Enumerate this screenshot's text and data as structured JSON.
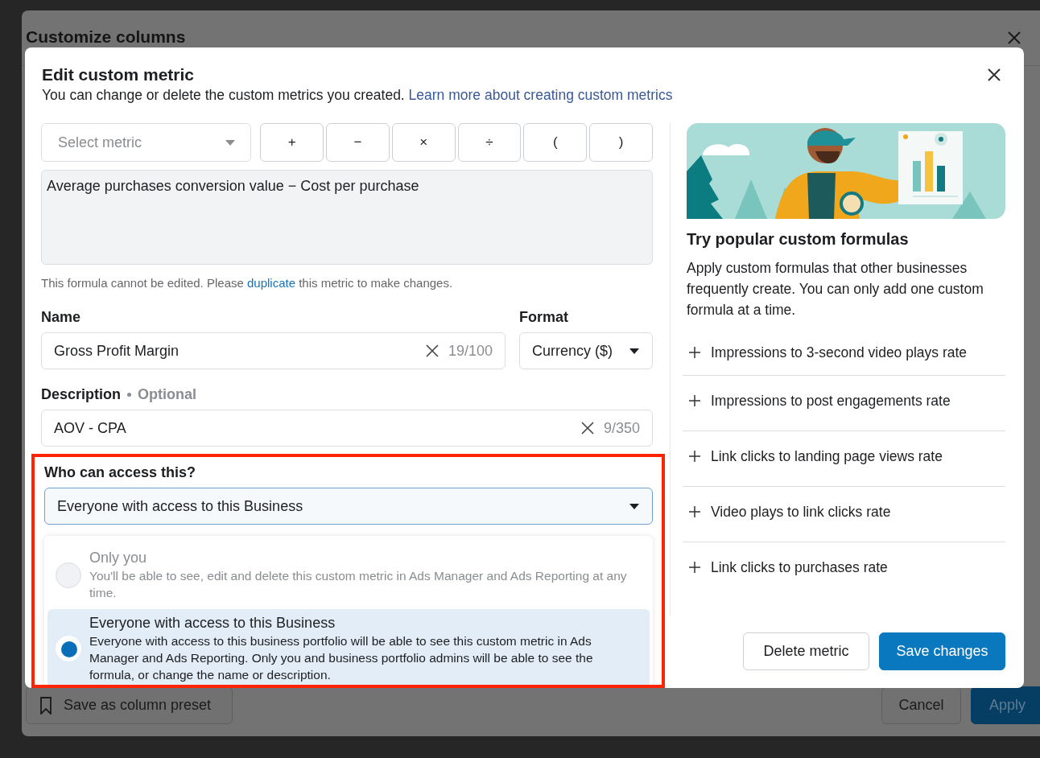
{
  "background_window": {
    "title": "Customize columns",
    "footer_left_button": "Save as column preset",
    "footer_buttons": [
      {
        "label": "Cancel",
        "kind": "secondary"
      },
      {
        "label": "Apply",
        "kind": "primary"
      }
    ]
  },
  "dialog": {
    "title": "Edit custom metric",
    "subtitle": "You can change or delete the custom metrics you created.",
    "subtitle_link": "Learn more about creating custom metrics",
    "metric_select": {
      "placeholder": "Select metric"
    },
    "operator_buttons": [
      "+",
      "−",
      "×",
      "÷",
      "(",
      ")"
    ],
    "formula": "Average purchases conversion value − Cost per purchase",
    "formula_note": {
      "before": "This formula cannot be edited. Please",
      "link": "duplicate",
      "after": "this metric to make changes."
    },
    "name_field": {
      "label": "Name",
      "value": "Gross Profit Margin",
      "counter": "19/100"
    },
    "format_field": {
      "label": "Format",
      "value": "Currency ($)"
    },
    "description_field": {
      "label": "Description",
      "optional": "Optional",
      "value": "AOV - CPA",
      "counter": "9/350"
    },
    "access": {
      "label": "Who can access this?",
      "value": "Everyone with access to this Business",
      "highlighted": true,
      "options": [
        {
          "title": "Only you",
          "description": "You'll be able to see, edit and delete this custom metric in Ads Manager and Ads Reporting at any time.",
          "selected": false,
          "disabled": true
        },
        {
          "title": "Everyone with access to this Business",
          "description": "Everyone with access to this business portfolio will be able to see this custom metric in Ads Manager and Ads Reporting. Only you and business portfolio admins will be able to see the formula, or change the name or description.",
          "selected": true,
          "disabled": false
        }
      ]
    },
    "suggestions": {
      "title": "Try popular custom formulas",
      "text": "Apply custom formulas that other businesses frequently create. You can only add one custom formula at a time.",
      "items": [
        "Impressions to 3-second video plays rate",
        "Impressions to post engagements rate",
        "Link clicks to landing page views rate",
        "Video plays to link clicks rate",
        "Link clicks to purchases rate"
      ]
    },
    "buttons": [
      {
        "label": "Delete metric",
        "kind": "secondary"
      },
      {
        "label": "Save changes",
        "kind": "primary"
      }
    ]
  }
}
